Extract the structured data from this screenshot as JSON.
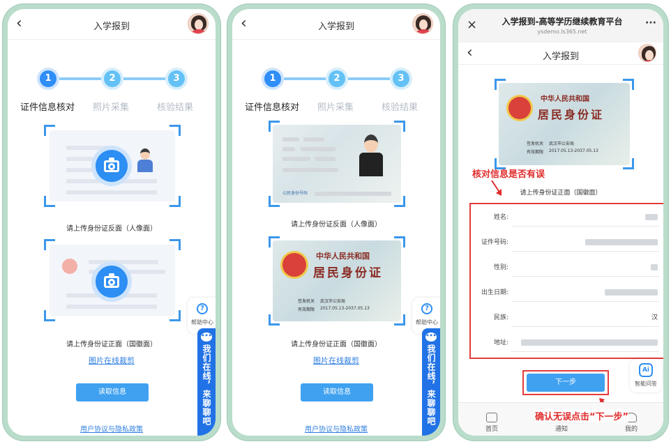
{
  "screen1": {
    "header_title": "入学报到",
    "steps": [
      {
        "num": "1",
        "label": "证件信息核对"
      },
      {
        "num": "2",
        "label": "照片采集"
      },
      {
        "num": "3",
        "label": "核验结果"
      }
    ],
    "back_caption": "请上传身份证反面（人像面）",
    "front_caption": "请上传身份证正面（国徽面）",
    "crop_link": "图片在线裁剪",
    "read_button": "读取信息",
    "help_label": "帮助中心",
    "chat_text": "我们在线，来聊聊吧",
    "policy_link": "用户协议与隐私政策"
  },
  "screen2": {
    "header_title": "入学报到",
    "steps": [
      {
        "num": "1",
        "label": "证件信息核对"
      },
      {
        "num": "2",
        "label": "照片采集"
      },
      {
        "num": "3",
        "label": "核验结果"
      }
    ],
    "back_caption": "请上传身份证反面（人像面）",
    "front_caption": "请上传身份证正面（国徽面）",
    "crop_link": "图片在线裁剪",
    "read_button": "读取信息",
    "help_label": "帮助中心",
    "chat_text": "我们在线，来聊聊吧",
    "policy_link": "用户协议与隐私政策",
    "id_front_line1": "中华人民共和国",
    "id_front_line2": "居民身份证",
    "id_authority_label": "签发机关",
    "id_authority_value": "武汉市公安局",
    "id_valid_label": "有效期限",
    "id_valid_value": "2017.05.13-2037.05.13",
    "id_back_number_label": "公民身份号码"
  },
  "screen3": {
    "browser_title": "入学报到-高等学历继续教育平台",
    "browser_url": "ysdemo.ls365.net",
    "header_title": "入学报到",
    "id_front_line1": "中华人民共和国",
    "id_front_line2": "居民身份证",
    "id_authority_label": "签发机关",
    "id_authority_value": "武汉市公安局",
    "id_valid_label": "有效期限",
    "id_valid_value": "2017.05.13-2037.05.13",
    "annotation_check": "核对信息是否有误",
    "front_caption": "请上传身份证正面（国徽面）",
    "fields": [
      {
        "label": "姓名:",
        "value": ""
      },
      {
        "label": "证件号码:",
        "value": ""
      },
      {
        "label": "性别:",
        "value": ""
      },
      {
        "label": "出生日期:",
        "value": ""
      },
      {
        "label": "民族:",
        "value": "汉"
      },
      {
        "label": "地址:",
        "value": ""
      }
    ],
    "next_button": "下一步",
    "annotation_next": "确认无误点击“下一步”",
    "ai_label": "智能问答",
    "tabs": [
      {
        "label": "首页"
      },
      {
        "label": "通知"
      },
      {
        "label": "我的"
      }
    ]
  },
  "colors": {
    "primary": "#2d8ef3",
    "button": "#3fa1f0",
    "annotation_red": "#e12c2c",
    "chat_blue": "#2172e6"
  }
}
